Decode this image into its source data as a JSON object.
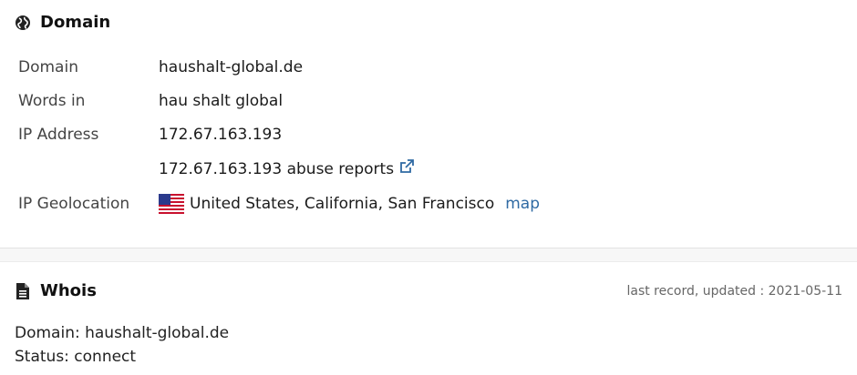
{
  "domain_section": {
    "title": "Domain",
    "rows": {
      "domain": {
        "label": "Domain",
        "value": "haushalt-global.de"
      },
      "words": {
        "label": "Words in",
        "value": "hau shalt global"
      },
      "ip": {
        "label": "IP Address",
        "value": "172.67.163.193",
        "abuse": "172.67.163.193 abuse reports"
      },
      "geo": {
        "label": "IP Geolocation",
        "value": "United States, California, San Francisco",
        "map": "map"
      }
    }
  },
  "whois_section": {
    "title": "Whois",
    "updated": "last record, updated : 2021-05-11",
    "lines": [
      "Domain: haushalt-global.de",
      "Status: connect"
    ]
  },
  "colors": {
    "link": "#2f6aa3",
    "text": "#222222",
    "label": "#444444"
  },
  "icons": {
    "domain": "globe-icon",
    "whois": "document-icon",
    "external": "external-link-icon",
    "flag": "us-flag-icon"
  }
}
